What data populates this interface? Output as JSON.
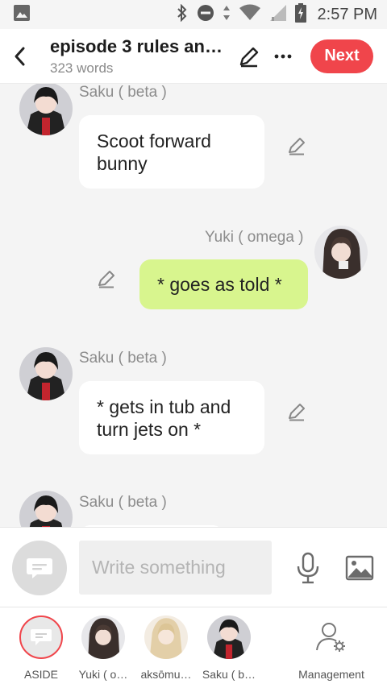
{
  "status_bar": {
    "time": "2:57 PM"
  },
  "header": {
    "title": "episode 3 rules an…",
    "subtitle": "323 words",
    "next_label": "Next"
  },
  "messages": [
    {
      "name": "Saku ( beta )",
      "text": "Scoot forward bunny"
    },
    {
      "name": "Yuki ( omega )",
      "text": "* goes as told *"
    },
    {
      "name": "Saku ( beta )",
      "text": "* gets in tub and turn jets on *"
    },
    {
      "name": "Saku ( beta )",
      "text": ""
    }
  ],
  "composer": {
    "placeholder": "Write something"
  },
  "characters": [
    {
      "label": "ASIDE"
    },
    {
      "label": "Yuki ( o…"
    },
    {
      "label": "aksōmu…"
    },
    {
      "label": "Saku ( b…"
    },
    {
      "label": "Management"
    }
  ],
  "colors": {
    "accent": "#f0454b",
    "my_bubble": "#d8f58e",
    "name_text": "#8c8c8c"
  }
}
